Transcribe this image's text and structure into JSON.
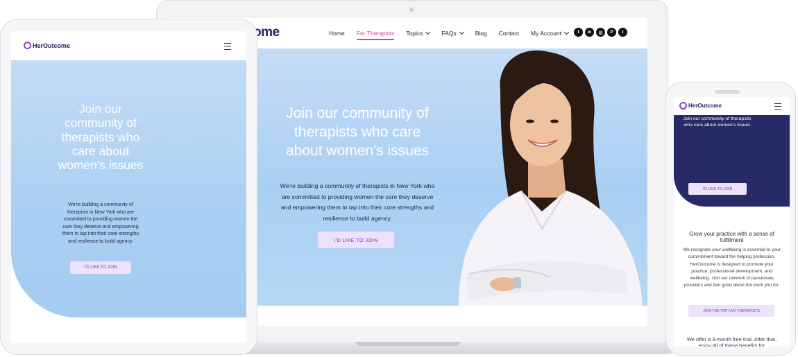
{
  "laptop": {
    "logo": "ome",
    "nav": {
      "home": "Home",
      "therapists": "For Therapists",
      "topics": "Topics",
      "faqs": "FAQs",
      "blog": "Blog",
      "contact": "Contact",
      "account": "My Account"
    },
    "social": {
      "facebook": "f",
      "linkedin": "in",
      "instagram": "◎",
      "pinterest": "P",
      "twitter": "t"
    },
    "hero": {
      "title": "Join our community of therapists who care about women's issues",
      "body": "We're building a community of therapists in New York who are committed to providing women the care they deserve and empowering them to tap into their core strengths and resilience to build agency.",
      "button": "I'D LIKE TO JOIN"
    }
  },
  "tablet": {
    "logo": "HerOutcome",
    "hero": {
      "title": "Join our community of therapists who care about women's issues",
      "body": "We're building a community of therapists in New York who are committed to providing women the care they deserve and empowering them to tap into their core strengths and resilience to build agency.",
      "button": "I'D LIKE TO JOIN"
    }
  },
  "phone": {
    "logo": "HerOutcome",
    "hero": {
      "title": "Join our community of therapists who care about women's issues",
      "button": "I'D LIKE TO JOIN"
    },
    "section": {
      "subtitle": "Grow your practice with a sense of fulfillment",
      "paragraph": "We recognize your wellbeing is essential to your commitment toward the helping profession. HerOutcome is designed to promote your practice, professional development, and wellbeing. Join our network of passionate providers and feel good about the work you do.",
      "button": "JOIN THE TOP NYC THERAPISTS",
      "footer": "We offer a 3-month free trial. After that, enjoy all of these benefits for"
    }
  },
  "colors": {
    "brand_navy": "#1f2460",
    "accent_pink": "#d43fa1",
    "button_bg": "#ece2fb",
    "button_text": "#7b35c9",
    "hero_blue": "#a9cff3",
    "phone_hero": "#262a66"
  }
}
